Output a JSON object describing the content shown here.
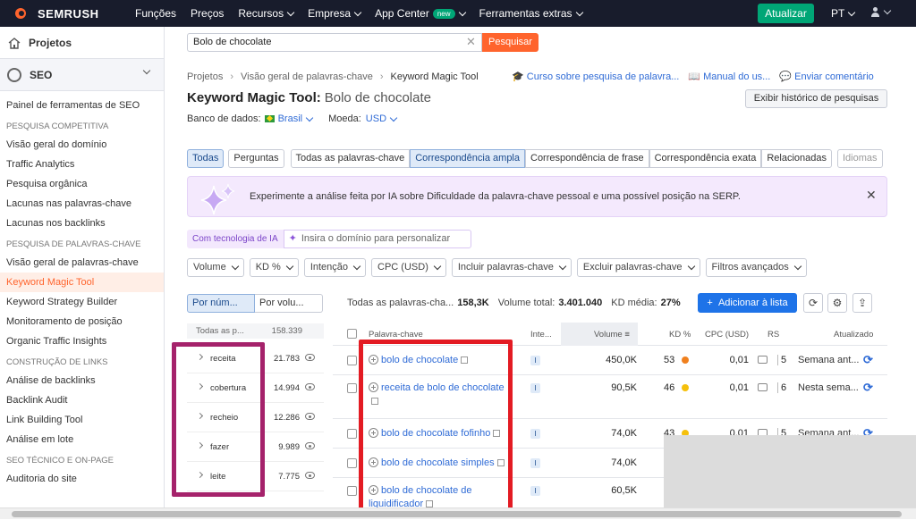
{
  "topbar": {
    "brand": "SEMRUSH",
    "nav": [
      {
        "label": "Funções",
        "chevron": false,
        "badge": ""
      },
      {
        "label": "Preços",
        "chevron": false,
        "badge": ""
      },
      {
        "label": "Recursos",
        "chevron": true,
        "badge": ""
      },
      {
        "label": "Empresa",
        "chevron": true,
        "badge": ""
      },
      {
        "label": "App Center",
        "chevron": true,
        "badge": "new"
      },
      {
        "label": "Ferramentas extras",
        "chevron": true,
        "badge": ""
      }
    ],
    "upgrade_label": "Atualizar",
    "lang": "PT"
  },
  "sidebar": {
    "projects_label": "Projetos",
    "seo_label": "SEO",
    "items": [
      {
        "type": "item",
        "label": "Painel de ferramentas de SEO"
      },
      {
        "type": "section",
        "label": "PESQUISA COMPETITIVA"
      },
      {
        "type": "item",
        "label": "Visão geral do domínio"
      },
      {
        "type": "item",
        "label": "Traffic Analytics"
      },
      {
        "type": "item",
        "label": "Pesquisa orgânica"
      },
      {
        "type": "item",
        "label": "Lacunas nas palavras-chave"
      },
      {
        "type": "item",
        "label": "Lacunas nos backlinks"
      },
      {
        "type": "section",
        "label": "PESQUISA DE PALAVRAS-CHAVE"
      },
      {
        "type": "item",
        "label": "Visão geral de palavras-chave"
      },
      {
        "type": "item",
        "label": "Keyword Magic Tool",
        "active": true
      },
      {
        "type": "item",
        "label": "Keyword Strategy Builder"
      },
      {
        "type": "item",
        "label": "Monitoramento de posição"
      },
      {
        "type": "item",
        "label": "Organic Traffic Insights"
      },
      {
        "type": "section",
        "label": "CONSTRUÇÃO DE LINKS"
      },
      {
        "type": "item",
        "label": "Análise de backlinks"
      },
      {
        "type": "item",
        "label": "Backlink Audit"
      },
      {
        "type": "item",
        "label": "Link Building Tool"
      },
      {
        "type": "item",
        "label": "Análise em lote"
      },
      {
        "type": "section",
        "label": "SEO TÉCNICO E ON-PAGE"
      },
      {
        "type": "item",
        "label": "Auditoria do site"
      }
    ]
  },
  "search": {
    "value": "Bolo de chocolate",
    "button_label": "Pesquisar"
  },
  "breadcrumb": [
    "Projetos",
    "Visão geral de palavras-chave",
    "Keyword Magic Tool"
  ],
  "top_links": [
    "Curso sobre pesquisa de palavra...",
    "Manual do us...",
    "Enviar comentário"
  ],
  "page": {
    "title": "Keyword Magic Tool:",
    "query": "Bolo de chocolate",
    "history_button": "Exibir histórico de pesquisas",
    "db_label": "Banco de dados:",
    "db_value": "Brasil",
    "currency_label": "Moeda:",
    "currency_value": "USD"
  },
  "tabs": {
    "group1": [
      "Todas",
      "Perguntas"
    ],
    "group2": [
      "Todas as palavras-chave",
      "Correspondência ampla",
      "Correspondência de frase",
      "Correspondência exata",
      "Relacionadas"
    ],
    "languages": "Idiomas"
  },
  "banner": {
    "text": "Experimente a análise feita por IA sobre Dificuldade da palavra-chave pessoal e uma possível posição na SERP."
  },
  "ai": {
    "label": "Com tecnologia de IA",
    "placeholder": "Insira o domínio para personalizar"
  },
  "filters": [
    "Volume",
    "KD %",
    "Intenção",
    "CPC (USD)",
    "Incluir palavras-chave",
    "Excluir palavras-chave",
    "Filtros avançados"
  ],
  "groups_panel": {
    "toggle": [
      "Por núm...",
      "Por volu..."
    ],
    "header_label": "Todas as p...",
    "header_count": "158.339",
    "rows": [
      {
        "label": "receita",
        "count": "21.783"
      },
      {
        "label": "cobertura",
        "count": "14.994"
      },
      {
        "label": "recheio",
        "count": "12.286"
      },
      {
        "label": "fazer",
        "count": "9.989"
      },
      {
        "label": "leite",
        "count": "7.775"
      }
    ]
  },
  "table": {
    "summary": {
      "all_label": "Todas as palavras-cha...",
      "all_value": "158,3K",
      "volume_label": "Volume total:",
      "volume_value": "3.401.040",
      "kd_label": "KD média:",
      "kd_value": "27%"
    },
    "add_button": "Adicionar à lista",
    "columns": [
      "Palavra-chave",
      "Inte...",
      "Volume",
      "KD %",
      "CPC (USD)",
      "RS",
      "Atualizado"
    ],
    "rows": [
      {
        "keyword": "bolo de chocolate",
        "intent": "I",
        "volume": "450,0K",
        "kd": "53",
        "kd_color": "#f0801e",
        "cpc": "0,01",
        "rs": "5",
        "updated": "Semana ant..."
      },
      {
        "keyword": "receita de bolo de chocolate",
        "intent": "I",
        "volume": "90,5K",
        "kd": "46",
        "kd_color": "#f5c00c",
        "cpc": "0,01",
        "rs": "6",
        "updated": "Nesta sema..."
      },
      {
        "keyword": "bolo de chocolate fofinho",
        "intent": "I",
        "volume": "74,0K",
        "kd": "43",
        "kd_color": "#f5c00c",
        "cpc": "0,01",
        "rs": "5",
        "updated": "Semana ant..."
      },
      {
        "keyword": "bolo de chocolate simples",
        "intent": "I",
        "volume": "74,0K",
        "kd": "",
        "kd_color": "",
        "cpc": "",
        "rs": "",
        "updated": ""
      },
      {
        "keyword": "bolo de chocolate de liquidificador",
        "intent": "I",
        "volume": "60,5K",
        "kd": "",
        "kd_color": "",
        "cpc": "",
        "rs": "",
        "updated": ""
      }
    ]
  },
  "colors": {
    "brand": "#ff642d",
    "accent": "#1e73e8",
    "upgrade": "#00a676",
    "highlight_purple": "#a5226b",
    "highlight_red": "#e31b23"
  }
}
